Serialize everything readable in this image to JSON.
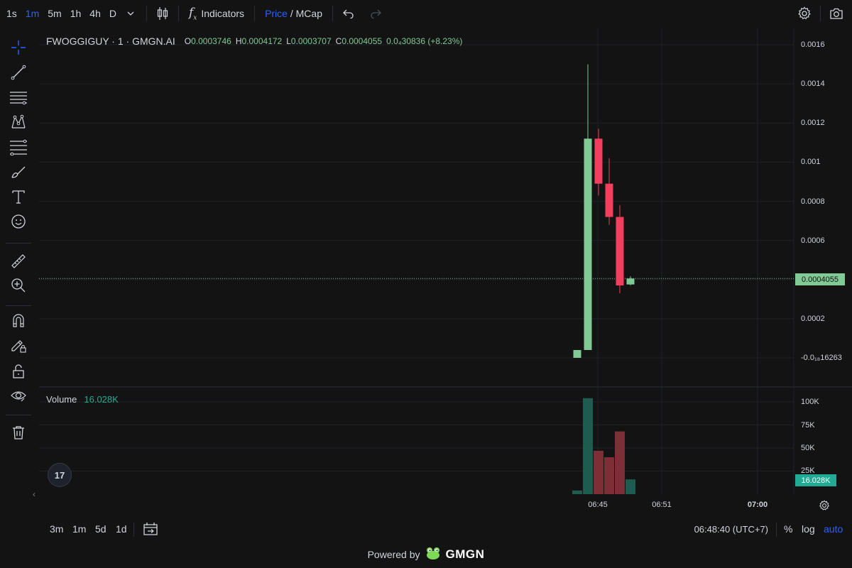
{
  "toolbar": {
    "timeframes": [
      "1s",
      "1m",
      "5m",
      "1h",
      "4h",
      "D"
    ],
    "active_timeframe": "1m",
    "indicators_label": "Indicators",
    "price_label": "Price",
    "mcap_label": "/ MCap"
  },
  "legend": {
    "symbol": "FWOGGIGUY · 1 · GMGN.AI",
    "open_label": "O",
    "open": "0.0003746",
    "high_label": "H",
    "high": "0.0004172",
    "low_label": "L",
    "low": "0.0003707",
    "close_label": "C",
    "close": "0.0004055",
    "change": "0.0₄30836 (+8.23%)"
  },
  "price_axis": [
    "0.0016",
    "0.0014",
    "0.0012",
    "0.001",
    "0.0008",
    "0.0006",
    "0.0002",
    "-0.0₁₈16263"
  ],
  "current_price_tag": "0.0004055",
  "volume": {
    "label": "Volume",
    "value": "16.028K",
    "axis": [
      "100K",
      "75K",
      "50K",
      "25K"
    ],
    "tag": "16.028K"
  },
  "time_axis": [
    "06:45",
    "06:51",
    "07:00"
  ],
  "bottom": {
    "ranges": [
      "3m",
      "1m",
      "5d",
      "1d"
    ],
    "clock": "06:48:40 (UTC+7)",
    "percent": "%",
    "log": "log",
    "auto": "auto"
  },
  "footer": {
    "powered_by": "Powered by",
    "brand": "GMGN"
  },
  "tv_logo": "17",
  "colors": {
    "up": "#81c995",
    "down": "#f23f5d",
    "vol_up": "#1d5c4f",
    "vol_down": "#7d2e36",
    "accent": "#2962ff",
    "background": "#131313"
  },
  "candles": [
    {
      "t": 0,
      "open": 0.0,
      "close": 4e-05,
      "high": 4e-05,
      "low": 0.0,
      "volume": 4000
    },
    {
      "t": 1,
      "open": 4e-05,
      "close": 0.00112,
      "high": 0.0015,
      "low": 4e-05,
      "volume": 104000
    },
    {
      "t": 2,
      "open": 0.00112,
      "close": 0.00089,
      "high": 0.00117,
      "low": 0.00083,
      "volume": 47000
    },
    {
      "t": 3,
      "open": 0.00089,
      "close": 0.00072,
      "high": 0.00102,
      "low": 0.00068,
      "volume": 40000
    },
    {
      "t": 4,
      "open": 0.00072,
      "close": 0.00037,
      "high": 0.00078,
      "low": 0.00033,
      "volume": 68000
    },
    {
      "t": 5,
      "open": 0.000375,
      "close": 0.0004055,
      "high": 0.000417,
      "low": 0.00037,
      "volume": 16028
    }
  ]
}
